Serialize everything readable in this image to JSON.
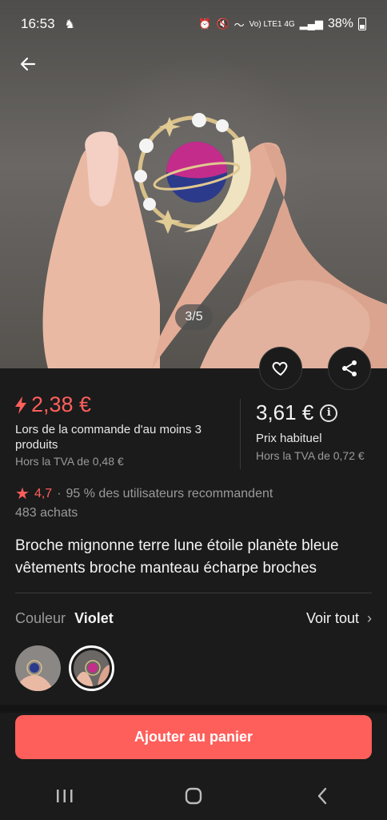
{
  "status_bar": {
    "time": "16:53",
    "network": "Vo) LTE1 4G",
    "battery": "38%"
  },
  "gallery": {
    "page_indicator": "3/5"
  },
  "price": {
    "promo_price": "2,38 €",
    "promo_condition": "Lors de la commande d'au moins 3 produits",
    "promo_tax": "Hors la TVA de 0,48 €",
    "regular_price": "3,61 €",
    "regular_label": "Prix habituel",
    "regular_tax": "Hors la TVA de 0,72 €"
  },
  "rating": {
    "score": "4,7",
    "separator": "·",
    "recommend": "95 % des utilisateurs recommandent",
    "purchases": "483 achats"
  },
  "product": {
    "title": "Broche mignonne terre lune étoile planète bleue vêtements broche manteau écharpe broches"
  },
  "variant": {
    "label": "Couleur",
    "value": "Violet",
    "see_all": "Voir tout",
    "options": [
      "bleu",
      "violet"
    ],
    "selected_index": 1
  },
  "actions": {
    "add_to_cart": "Ajouter au panier"
  },
  "colors": {
    "accent": "#ff5f5b",
    "background": "#1b1b1b"
  }
}
